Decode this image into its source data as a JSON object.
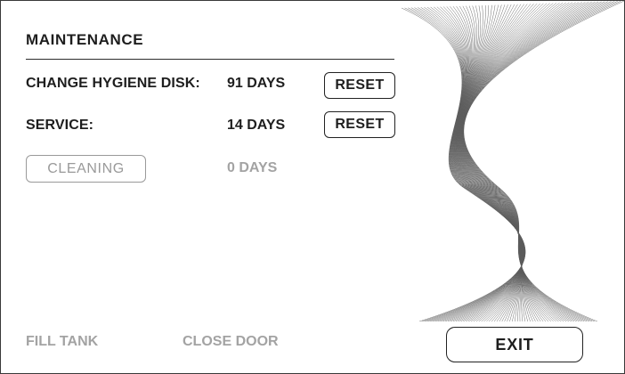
{
  "header": {
    "title": "MAINTENANCE"
  },
  "rows": [
    {
      "label": "CHANGE HYGIENE DISK:",
      "value": "91 DAYS",
      "button": "RESET"
    },
    {
      "label": "SERVICE:",
      "value": "14 DAYS",
      "button": "RESET"
    },
    {
      "label": "CLEANING",
      "value": "0 DAYS"
    }
  ],
  "footer": {
    "fill_tank": "FILL TANK",
    "close_door": "CLOSE DOOR",
    "exit": "EXIT"
  },
  "colors": {
    "text": "#1e1e1e",
    "disabled": "#a3a3a3",
    "border": "#222222",
    "art_stroke": "#333333"
  },
  "icons": {
    "decoration": "wave-ribbon-art"
  }
}
